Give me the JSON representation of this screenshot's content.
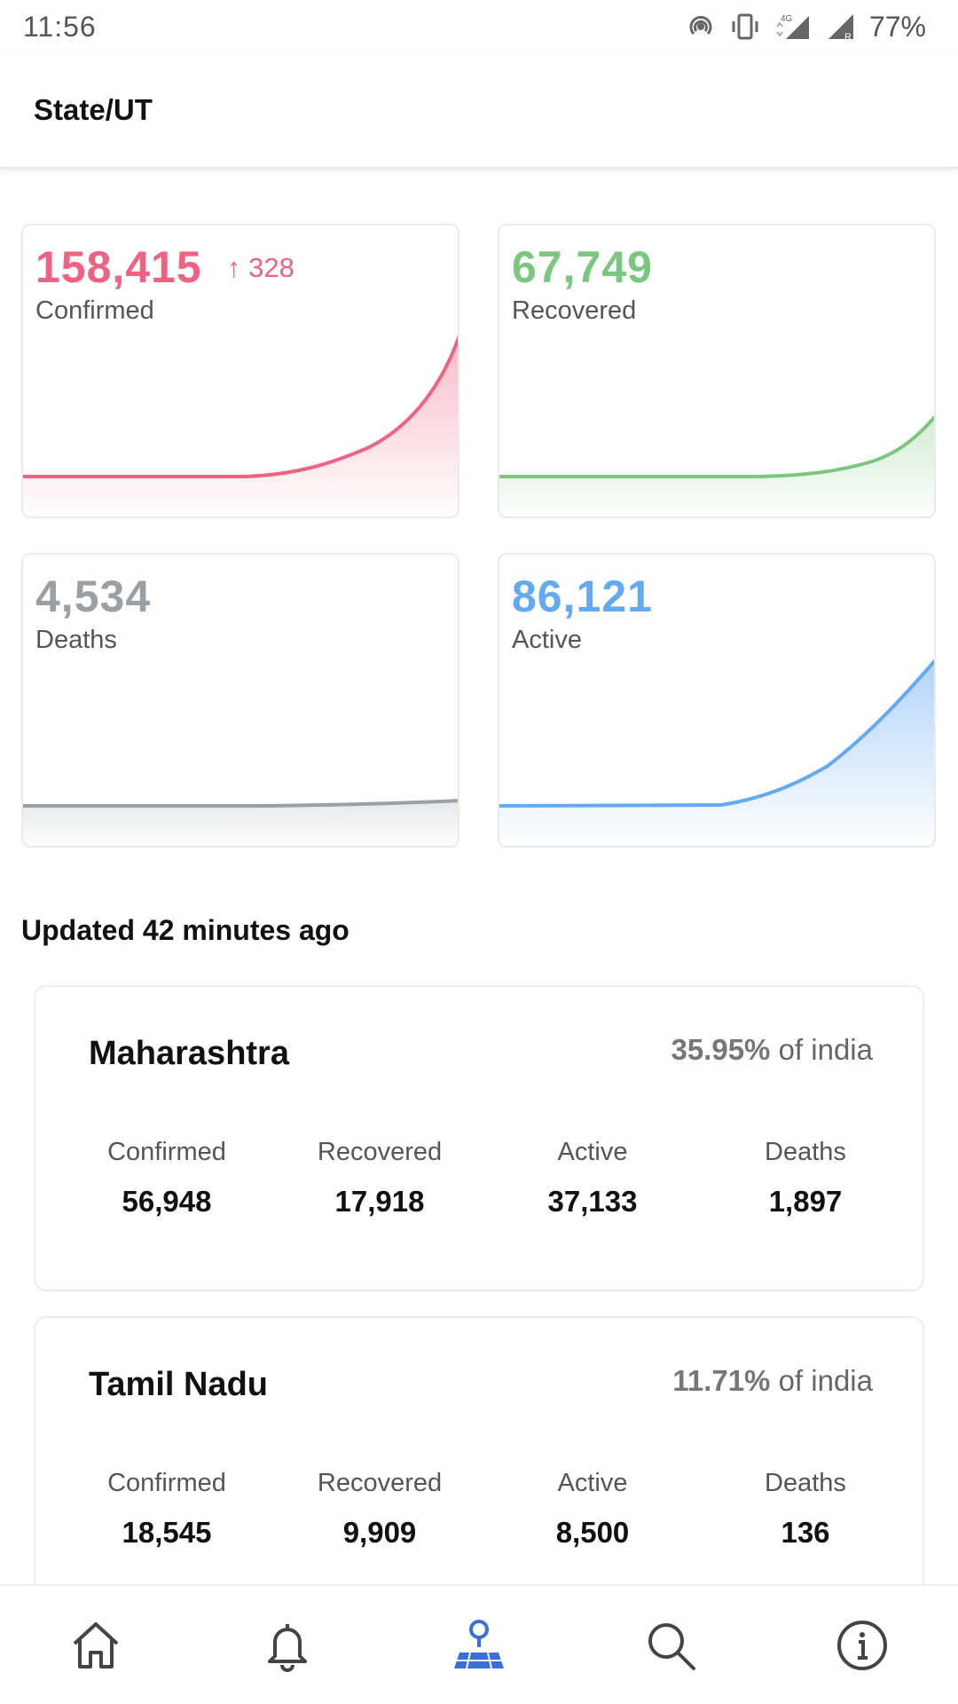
{
  "status_bar": {
    "time": "11:56",
    "battery": "77%",
    "network": "4G"
  },
  "header": {
    "title": "State/UT"
  },
  "summary": {
    "confirmed": {
      "value": "158,415",
      "delta": "↑ 328",
      "label": "Confirmed",
      "color": "#f06282"
    },
    "recovered": {
      "value": "67,749",
      "label": "Recovered",
      "color": "#7cc77f"
    },
    "deaths": {
      "value": "4,534",
      "label": "Deaths",
      "color": "#9aa0a6"
    },
    "active": {
      "value": "86,121",
      "label": "Active",
      "color": "#64a9f4"
    }
  },
  "updated_text": "Updated 42 minutes ago",
  "states": [
    {
      "name": "Maharashtra",
      "share_pct": "35.95%",
      "share_suffix": " of india",
      "labels": [
        "Confirmed",
        "Recovered",
        "Active",
        "Deaths"
      ],
      "values": [
        "56,948",
        "17,918",
        "37,133",
        "1,897"
      ]
    },
    {
      "name": "Tamil Nadu",
      "share_pct": "11.71%",
      "share_suffix": " of india",
      "labels": [
        "Confirmed",
        "Recovered",
        "Active",
        "Deaths"
      ],
      "values": [
        "18,545",
        "9,909",
        "8,500",
        "136"
      ]
    }
  ],
  "nav": [
    {
      "name": "home-icon"
    },
    {
      "name": "bell-icon"
    },
    {
      "name": "map-pin-icon",
      "active": true,
      "color": "#3b6fd8"
    },
    {
      "name": "search-icon"
    },
    {
      "name": "info-icon"
    }
  ]
}
